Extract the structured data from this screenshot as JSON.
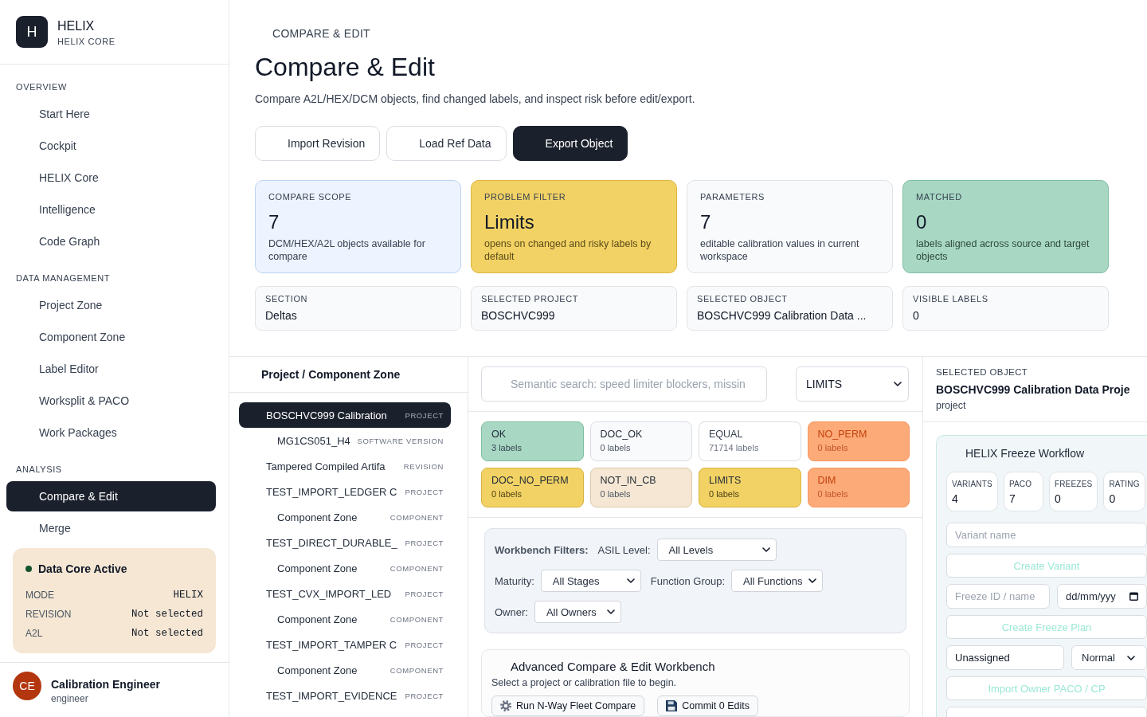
{
  "sidebar": {
    "brand": {
      "logo": "H",
      "name": "HELIX",
      "subtitle": "HELIX CORE"
    },
    "sections": [
      {
        "title": "OVERVIEW",
        "items": [
          {
            "label": "Start Here",
            "selected": false
          },
          {
            "label": "Cockpit",
            "selected": false
          },
          {
            "label": "HELIX Core",
            "selected": false
          },
          {
            "label": "Intelligence",
            "selected": false
          },
          {
            "label": "Code Graph",
            "selected": false
          }
        ]
      },
      {
        "title": "DATA MANAGEMENT",
        "items": [
          {
            "label": "Project Zone",
            "selected": false
          },
          {
            "label": "Component Zone",
            "selected": false
          },
          {
            "label": "Label Editor",
            "selected": false
          },
          {
            "label": "Worksplit & PACO",
            "selected": false
          },
          {
            "label": "Work Packages",
            "selected": false
          }
        ]
      },
      {
        "title": "ANALYSIS",
        "items": [
          {
            "label": "Compare & Edit",
            "selected": true
          },
          {
            "label": "Merge",
            "selected": false
          }
        ]
      }
    ],
    "status_card": {
      "title": "Data Core Active",
      "active": true,
      "rows": [
        {
          "label": "MODE",
          "value": "HELIX"
        },
        {
          "label": "REVISION",
          "value": "Not selected"
        },
        {
          "label": "A2L",
          "value": "Not selected"
        }
      ]
    },
    "user": {
      "initials": "CE",
      "name": "Calibration Engineer",
      "role": "engineer"
    }
  },
  "header": {
    "breadcrumb": "COMPARE & EDIT",
    "title": "Compare & Edit",
    "description": "Compare A2L/HEX/DCM objects, find changed labels, and inspect risk before edit/export.",
    "actions": [
      {
        "label": "Import Revision",
        "kind": "secondary"
      },
      {
        "label": "Load Ref Data",
        "kind": "secondary"
      },
      {
        "label": "Export Object",
        "kind": "primary"
      }
    ]
  },
  "stat_cards": [
    {
      "label": "COMPARE SCOPE",
      "value": "7",
      "description": "DCM/HEX/A2L objects available for compare",
      "kind": "info"
    },
    {
      "label": "PROBLEM FILTER",
      "value": "Limits",
      "description": "opens on changed and risky labels by default",
      "kind": "warning"
    },
    {
      "label": "PARAMETERS",
      "value": "7",
      "description": "editable calibration values in current workspace",
      "kind": "neutral"
    },
    {
      "label": "MATCHED",
      "value": "0",
      "description": "labels aligned across source and target objects",
      "kind": "success"
    }
  ],
  "info_cards": [
    {
      "label": "SECTION",
      "value": "Deltas"
    },
    {
      "label": "SELECTED PROJECT",
      "value": "BOSCHVC999"
    },
    {
      "label": "SELECTED OBJECT",
      "value": "BOSCHVC999 Calibration Data ..."
    },
    {
      "label": "VISIBLE LABELS",
      "value": "0"
    }
  ],
  "tree_panel": {
    "title": "Project / Component Zone",
    "items": [
      {
        "label": "BOSCHVC999 Calibration",
        "tag": "PROJECT",
        "selected": true,
        "children": [
          {
            "label": "MG1CS051_H4",
            "tag": "SOFTWARE VERSION",
            "selected": false
          }
        ]
      },
      {
        "label": "Tampered Compiled Artifa",
        "tag": "REVISION",
        "selected": false
      },
      {
        "label": "TEST_IMPORT_LEDGER C",
        "tag": "PROJECT",
        "selected": false,
        "children": [
          {
            "label": "Component Zone",
            "tag": "COMPONENT",
            "selected": false
          }
        ]
      },
      {
        "label": "TEST_DIRECT_DURABLE_",
        "tag": "PROJECT",
        "selected": false,
        "children": [
          {
            "label": "Component Zone",
            "tag": "COMPONENT",
            "selected": false
          }
        ]
      },
      {
        "label": "TEST_CVX_IMPORT_LED",
        "tag": "PROJECT",
        "selected": false,
        "children": [
          {
            "label": "Component Zone",
            "tag": "COMPONENT",
            "selected": false
          }
        ]
      },
      {
        "label": "TEST_IMPORT_TAMPER C",
        "tag": "PROJECT",
        "selected": false,
        "children": [
          {
            "label": "Component Zone",
            "tag": "COMPONENT",
            "selected": false
          }
        ]
      },
      {
        "label": "TEST_IMPORT_EVIDENCE",
        "tag": "PROJECT",
        "selected": false
      }
    ]
  },
  "workbench": {
    "search": {
      "placeholder": "Semantic search: speed limiter blockers, missin"
    },
    "filter_select": {
      "value": "LIMITS"
    },
    "status_chips": [
      {
        "label": "OK",
        "count": "3 labels",
        "kind": "ok"
      },
      {
        "label": "DOC_OK",
        "count": "0 labels",
        "kind": "neutral"
      },
      {
        "label": "EQUAL",
        "count": "71714 labels",
        "kind": "plain"
      },
      {
        "label": "NO_PERM",
        "count": "0 labels",
        "kind": "danger"
      },
      {
        "label": "DOC_NO_PERM",
        "count": "0 labels",
        "kind": "warning"
      },
      {
        "label": "NOT_IN_CB",
        "count": "0 labels",
        "kind": "muted"
      },
      {
        "label": "LIMITS",
        "count": "0 labels",
        "kind": "warning"
      },
      {
        "label": "DIM",
        "count": "0 labels",
        "kind": "danger"
      }
    ],
    "filters": {
      "title": "Workbench Filters:",
      "rows": [
        [
          {
            "label": "ASIL Level:",
            "value": "All Levels"
          }
        ],
        [
          {
            "label": "Maturity:",
            "value": "All Stages"
          },
          {
            "label": "Function Group:",
            "value": "All Functions"
          }
        ],
        [
          {
            "label": "Owner:",
            "value": "All Owners"
          }
        ]
      ]
    },
    "advanced": {
      "title": "Advanced Compare & Edit Workbench",
      "message": "Select a project or calibration file to begin.",
      "buttons": [
        {
          "label": "Run N-Way Fleet Compare",
          "kind": "compare"
        },
        {
          "label": "Commit 0 Edits",
          "kind": "commit"
        }
      ]
    }
  },
  "detail_panel": {
    "label": "SELECTED OBJECT",
    "name": "BOSCHVC999 Calibration Data Proje",
    "type": "project",
    "freeze_workflow": {
      "title": "HELIX Freeze Workflow",
      "stats": [
        {
          "label": "VARIANTS",
          "value": "4"
        },
        {
          "label": "PACO",
          "value": "7"
        },
        {
          "label": "FREEZES",
          "value": "0"
        },
        {
          "label": "RATING",
          "value": "0"
        }
      ],
      "controls": [
        {
          "kind": "input",
          "placeholder": "Variant name"
        },
        {
          "kind": "button",
          "label": "Create Variant",
          "disabled": true
        },
        {
          "kind": "row",
          "fields": [
            {
              "kind": "input",
              "placeholder": "Freeze ID / name"
            },
            {
              "kind": "date",
              "placeholder": "dd/mm/yyy"
            }
          ]
        },
        {
          "kind": "button",
          "label": "Create Freeze Plan",
          "disabled": true
        },
        {
          "kind": "row",
          "fields": [
            {
              "kind": "input",
              "value": "Unassigned"
            },
            {
              "kind": "select",
              "value": "Normal"
            }
          ]
        },
        {
          "kind": "button",
          "label": "Import Owner PACO / CP",
          "disabled": true
        },
        {
          "kind": "button"
        }
      ]
    }
  }
}
